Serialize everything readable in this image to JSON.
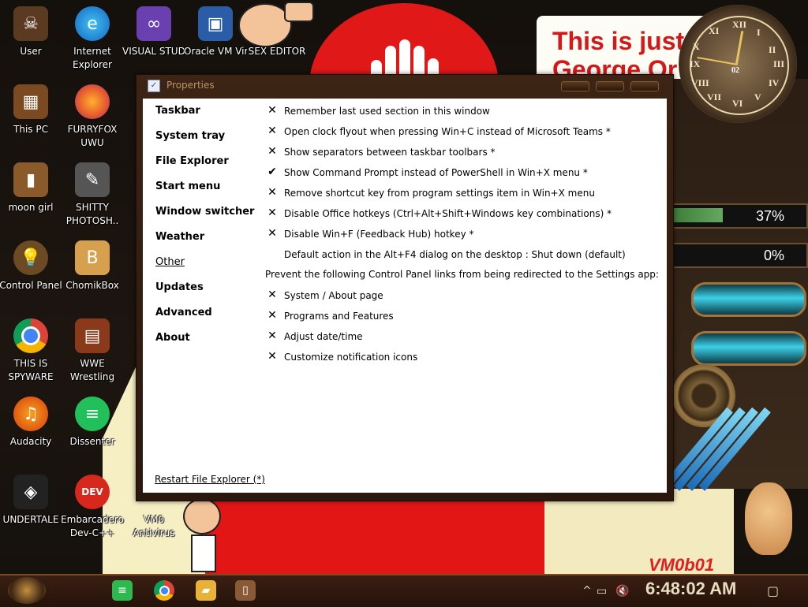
{
  "desktop": {
    "icons": [
      {
        "label": "User",
        "name": "desktop-icon-user"
      },
      {
        "label": "Internet Explorer",
        "name": "desktop-icon-internet-explorer"
      },
      {
        "label": "VISUAL STUDIO",
        "name": "desktop-icon-visual-studio"
      },
      {
        "label": "Oracle VM VirtualBox",
        "name": "desktop-icon-oracle-vm"
      },
      {
        "label": "SEX EDITOR",
        "name": "desktop-icon-sex-editor"
      },
      {
        "label": "This PC",
        "name": "desktop-icon-this-pc"
      },
      {
        "label": "FURRYFOX UWU",
        "name": "desktop-icon-furryfox"
      },
      {
        "label": "moon girl",
        "name": "desktop-icon-moon-girl"
      },
      {
        "label": "SHITTY PHOTOSH..",
        "name": "desktop-icon-photoshop"
      },
      {
        "label": "Control Panel",
        "name": "desktop-icon-control-panel"
      },
      {
        "label": "ChomikBox",
        "name": "desktop-icon-chomikbox"
      },
      {
        "label": "THIS IS SPYWARE",
        "name": "desktop-icon-chrome"
      },
      {
        "label": "WWE Wrestling",
        "name": "desktop-icon-wwe"
      },
      {
        "label": "Audacity",
        "name": "desktop-icon-audacity"
      },
      {
        "label": "Dissenter",
        "name": "desktop-icon-dissenter"
      },
      {
        "label": "UNDERTALE",
        "name": "desktop-icon-undertale"
      },
      {
        "label": "Embarcadero Dev-C++",
        "name": "desktop-icon-devcpp"
      },
      {
        "label": "VM0 Antivirus",
        "name": "desktop-icon-vm0-antivirus"
      }
    ],
    "wallpaper_text": "This is just\nGeorge Or",
    "gauge1": "37%",
    "gauge1_level": 0.37,
    "gauge2": "0%",
    "gauge2_level": 0.0,
    "clock_numbers": [
      "XII",
      "I",
      "II",
      "III",
      "IV",
      "V",
      "VI",
      "VII",
      "VIII",
      "IX",
      "X",
      "XI"
    ],
    "watermark": "VM0b01",
    "clock_badge": "02"
  },
  "window": {
    "title": "Properties",
    "nav": [
      {
        "label": "Taskbar",
        "selected": false
      },
      {
        "label": "System tray",
        "selected": false
      },
      {
        "label": "File Explorer",
        "selected": false
      },
      {
        "label": "Start menu",
        "selected": false
      },
      {
        "label": "Window switcher",
        "selected": false
      },
      {
        "label": "Weather",
        "selected": false
      },
      {
        "label": "Other",
        "selected": true
      },
      {
        "label": "Updates",
        "selected": false
      },
      {
        "label": "Advanced",
        "selected": false
      },
      {
        "label": "About",
        "selected": false
      }
    ],
    "options": [
      {
        "mark": "✕",
        "text": "Remember last used section in this window"
      },
      {
        "mark": "✕",
        "text": "Open clock flyout when pressing Win+C instead of Microsoft Teams *"
      },
      {
        "mark": "✕",
        "text": "Show separators between taskbar toolbars *"
      },
      {
        "mark": "✔",
        "text": "Show Command Prompt instead of PowerShell in Win+X menu *"
      },
      {
        "mark": "✕",
        "text": "Remove shortcut key from program settings item in Win+X menu"
      },
      {
        "mark": "✕",
        "text": "Disable Office hotkeys (Ctrl+Alt+Shift+Windows key combinations) *"
      },
      {
        "mark": "✕",
        "text": "Disable Win+F (Feedback Hub) hotkey *"
      },
      {
        "mark": "",
        "text": "Default action in the Alt+F4 dialog on the desktop : Shut down (default)"
      }
    ],
    "section_label": "Prevent the following Control Panel links from being redirected to the Settings app:",
    "redirect_options": [
      {
        "mark": "✕",
        "text": "System / About page"
      },
      {
        "mark": "✕",
        "text": "Programs and Features"
      },
      {
        "mark": "✕",
        "text": "Adjust date/time"
      },
      {
        "mark": "✕",
        "text": "Customize notification icons"
      }
    ],
    "restart_link": "Restart File Explorer (*)"
  },
  "taskbar": {
    "apps": [
      {
        "name": "taskbar-spotify",
        "icon": "≡",
        "color": "#2fb84f"
      },
      {
        "name": "taskbar-chrome",
        "icon": "●",
        "color": "#dd4b39"
      },
      {
        "name": "taskbar-file-explorer",
        "icon": "▰",
        "color": "#e8b23a"
      },
      {
        "name": "taskbar-door-app",
        "icon": "▯",
        "color": "#8a5a36"
      }
    ],
    "time": "6:48:02 AM",
    "chevron": "^"
  }
}
